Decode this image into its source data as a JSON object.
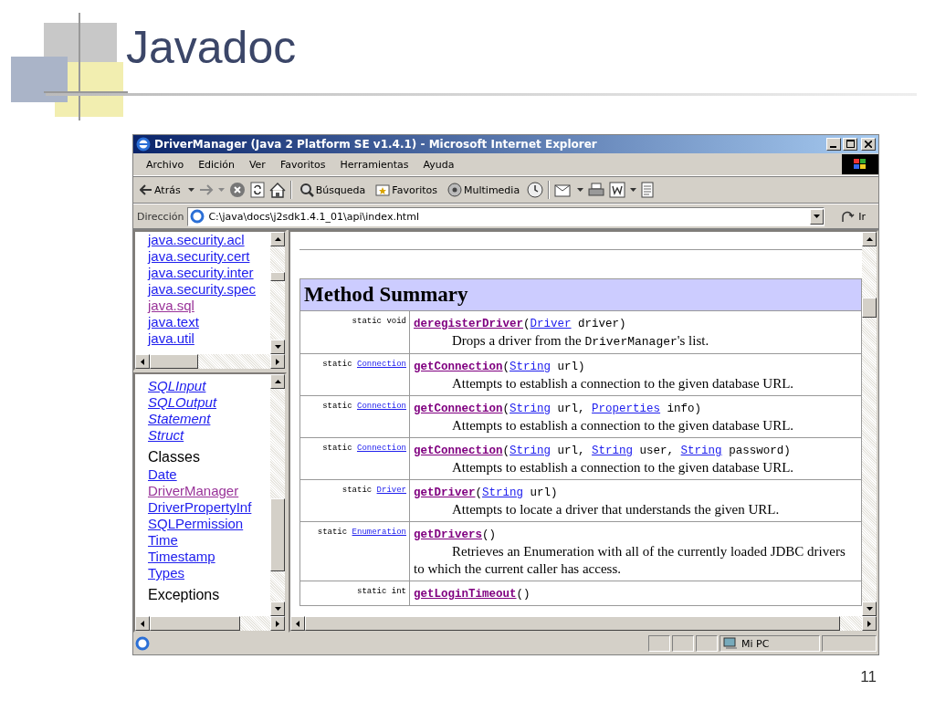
{
  "slide": {
    "title": "Javadoc",
    "page_number": "11"
  },
  "window": {
    "title": "DriverManager (Java 2 Platform SE v1.4.1) - Microsoft Internet Explorer"
  },
  "menu": [
    "Archivo",
    "Edición",
    "Ver",
    "Favoritos",
    "Herramientas",
    "Ayuda"
  ],
  "toolbar": {
    "back": "Atrás",
    "search": "Búsqueda",
    "favorites": "Favoritos",
    "media": "Multimedia"
  },
  "address_bar": {
    "label": "Dirección",
    "value": "C:\\java\\docs\\j2sdk1.4.1_01\\api\\index.html",
    "go": "Ir"
  },
  "packages_frame": {
    "items": [
      {
        "label": "java.security.acl",
        "visited": false
      },
      {
        "label": "java.security.cert",
        "visited": false
      },
      {
        "label": "java.security.inter",
        "visited": false
      },
      {
        "label": "java.security.spec",
        "visited": false
      },
      {
        "label": "java.sql",
        "visited": true
      },
      {
        "label": "java.text",
        "visited": false
      },
      {
        "label": "java.util",
        "visited": false
      }
    ]
  },
  "classes_frame": {
    "sections": [
      {
        "kind": "links",
        "items": [
          {
            "label": "SQLInput",
            "visited": false,
            "italic": true
          },
          {
            "label": "SQLOutput",
            "visited": false,
            "italic": true
          },
          {
            "label": "Statement",
            "visited": false,
            "italic": true
          },
          {
            "label": "Struct",
            "visited": false,
            "italic": true
          }
        ]
      },
      {
        "kind": "heading",
        "label": "Classes"
      },
      {
        "kind": "links",
        "items": [
          {
            "label": "Date",
            "visited": false,
            "italic": false
          },
          {
            "label": "DriverManager",
            "visited": true,
            "italic": false
          },
          {
            "label": "DriverPropertyInf",
            "visited": false,
            "italic": false
          },
          {
            "label": "SQLPermission",
            "visited": false,
            "italic": false
          },
          {
            "label": "Time",
            "visited": false,
            "italic": false
          },
          {
            "label": "Timestamp",
            "visited": false,
            "italic": false
          },
          {
            "label": "Types",
            "visited": false,
            "italic": false
          }
        ]
      },
      {
        "kind": "heading",
        "label": "Exceptions"
      }
    ]
  },
  "method_summary": {
    "title": "Method Summary",
    "rows": [
      {
        "modifier": "static",
        "type": "void",
        "type_link": false,
        "signature": [
          {
            "kind": "method",
            "text": "deregisterDriver"
          },
          {
            "kind": "text",
            "text": "("
          },
          {
            "kind": "link",
            "text": "Driver"
          },
          {
            "kind": "text",
            "text": " driver)"
          }
        ],
        "description": [
          {
            "kind": "text",
            "text": "Drops a driver from the "
          },
          {
            "kind": "code",
            "text": "DriverManager"
          },
          {
            "kind": "text",
            "text": "'s list."
          }
        ]
      },
      {
        "modifier": "static",
        "type": "Connection",
        "type_link": true,
        "signature": [
          {
            "kind": "method",
            "text": "getConnection"
          },
          {
            "kind": "text",
            "text": "("
          },
          {
            "kind": "link",
            "text": "String"
          },
          {
            "kind": "text",
            "text": " url)"
          }
        ],
        "description": [
          {
            "kind": "text",
            "text": "Attempts to establish a connection to the given database URL."
          }
        ]
      },
      {
        "modifier": "static",
        "type": "Connection",
        "type_link": true,
        "signature": [
          {
            "kind": "method",
            "text": "getConnection"
          },
          {
            "kind": "text",
            "text": "("
          },
          {
            "kind": "link",
            "text": "String"
          },
          {
            "kind": "text",
            "text": " url, "
          },
          {
            "kind": "link",
            "text": "Properties"
          },
          {
            "kind": "text",
            "text": " info)"
          }
        ],
        "description": [
          {
            "kind": "text",
            "text": "Attempts to establish a connection to the given database URL."
          }
        ]
      },
      {
        "modifier": "static",
        "type": "Connection",
        "type_link": true,
        "signature": [
          {
            "kind": "method",
            "text": "getConnection"
          },
          {
            "kind": "text",
            "text": "("
          },
          {
            "kind": "link",
            "text": "String"
          },
          {
            "kind": "text",
            "text": " url, "
          },
          {
            "kind": "link",
            "text": "String"
          },
          {
            "kind": "text",
            "text": " user, "
          },
          {
            "kind": "link",
            "text": "String"
          },
          {
            "kind": "text",
            "text": " password)"
          }
        ],
        "description": [
          {
            "kind": "text",
            "text": "Attempts to establish a connection to the given database URL."
          }
        ]
      },
      {
        "modifier": "static",
        "type": "Driver",
        "type_link": true,
        "signature": [
          {
            "kind": "method",
            "text": "getDriver"
          },
          {
            "kind": "text",
            "text": "("
          },
          {
            "kind": "link",
            "text": "String"
          },
          {
            "kind": "text",
            "text": " url)"
          }
        ],
        "description": [
          {
            "kind": "text",
            "text": "Attempts to locate a driver that understands the given URL."
          }
        ]
      },
      {
        "modifier": "static",
        "type": "Enumeration",
        "type_link": true,
        "signature": [
          {
            "kind": "method",
            "text": "getDrivers"
          },
          {
            "kind": "text",
            "text": "()"
          }
        ],
        "description": [
          {
            "kind": "text",
            "text": "Retrieves an Enumeration with all of the currently loaded JDBC drivers to which the current caller has access."
          }
        ]
      },
      {
        "modifier": "static",
        "type": "int",
        "type_link": false,
        "signature": [
          {
            "kind": "method",
            "text": "getLoginTimeout"
          },
          {
            "kind": "text",
            "text": "()"
          }
        ],
        "description": []
      }
    ]
  },
  "status_bar": {
    "zone": "Mi PC"
  }
}
